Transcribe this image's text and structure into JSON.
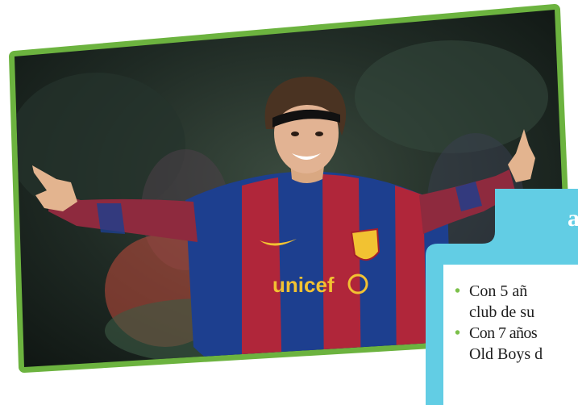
{
  "colors": {
    "card_border": "#6cb33f",
    "info_box_border": "#62cde4",
    "info_box_fill": "#ffffff",
    "bullet": "#7cc04a",
    "jersey_blue": "#1d3f8f",
    "jersey_red": "#b0263a"
  },
  "photo": {
    "alt": "Futbolista celebrando con los brazos abiertos",
    "jersey_sponsor": "unicef"
  },
  "info_box": {
    "heading": "a",
    "items": [
      {
        "line1": "Con 5 añ",
        "line2": "club de su"
      },
      {
        "line1": "Con 7 años",
        "line2": "Old Boys d"
      }
    ]
  }
}
